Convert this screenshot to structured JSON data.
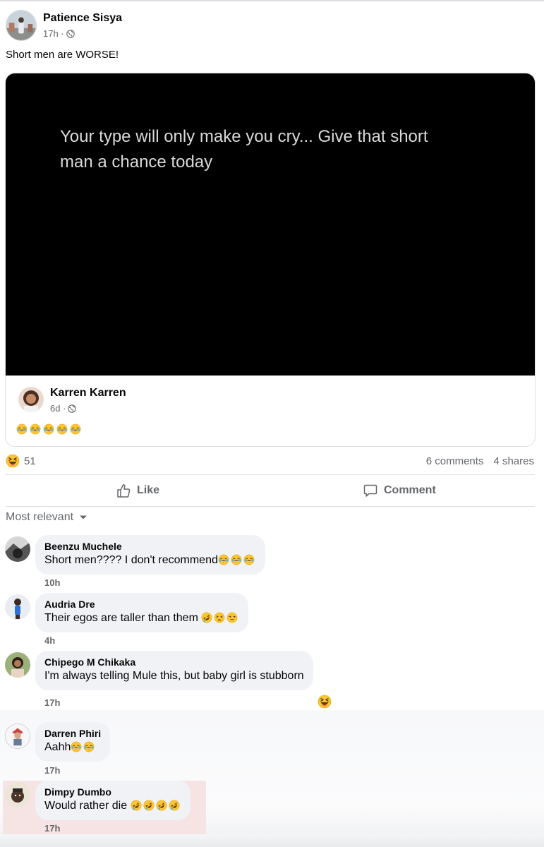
{
  "post": {
    "author": "Patience Sisya",
    "time": "17h ·",
    "text": "Short men are WORSE!"
  },
  "shared_post": {
    "video_caption": "Your type will only make you cry... Give that short man a chance today",
    "author": "Karren Karren",
    "time": "6d ·",
    "emoji_count": 5,
    "emoji": "tears-of-joy"
  },
  "reactions": {
    "emoji": "laughing-squinting",
    "count": "51",
    "comments": "6 comments",
    "shares": "4 shares"
  },
  "actions": {
    "like_label": "Like",
    "comment_label": "Comment"
  },
  "sort": {
    "label": "Most relevant"
  },
  "comments": [
    {
      "name": "Beenzu Muchele",
      "text": "Short men???? I don't recommend",
      "emoji": [
        "tears-of-joy",
        "tears-of-joy",
        "tears-of-joy"
      ],
      "time": "10h"
    },
    {
      "name": "Audria Dre",
      "text": "Their egos are taller than them ",
      "emoji": [
        "rolling-on-floor-laughing",
        "tired-face",
        "unamused-face"
      ],
      "time": "4h"
    },
    {
      "name": "Chipego M Chikaka",
      "text": "I'm always telling Mule this, but baby girl is stubborn",
      "emoji": [],
      "reaction": "laughing-squinting",
      "time": "17h"
    },
    {
      "name": "Darren Phiri",
      "text": "Aahh",
      "emoji": [
        "tears-of-joy",
        "tears-of-joy"
      ],
      "time": "17h"
    },
    {
      "name": "Dimpy Dumbo",
      "text": "Would rather die ",
      "emoji": [
        "rolling-on-floor-laughing",
        "rolling-on-floor-laughing",
        "rolling-on-floor-laughing",
        "rolling-on-floor-laughing"
      ],
      "time": "17h"
    }
  ],
  "colors": {
    "secondary_text": "#65676b",
    "bubble_bg": "#f0f2f5",
    "emoji_yellow": "#fdc640"
  }
}
